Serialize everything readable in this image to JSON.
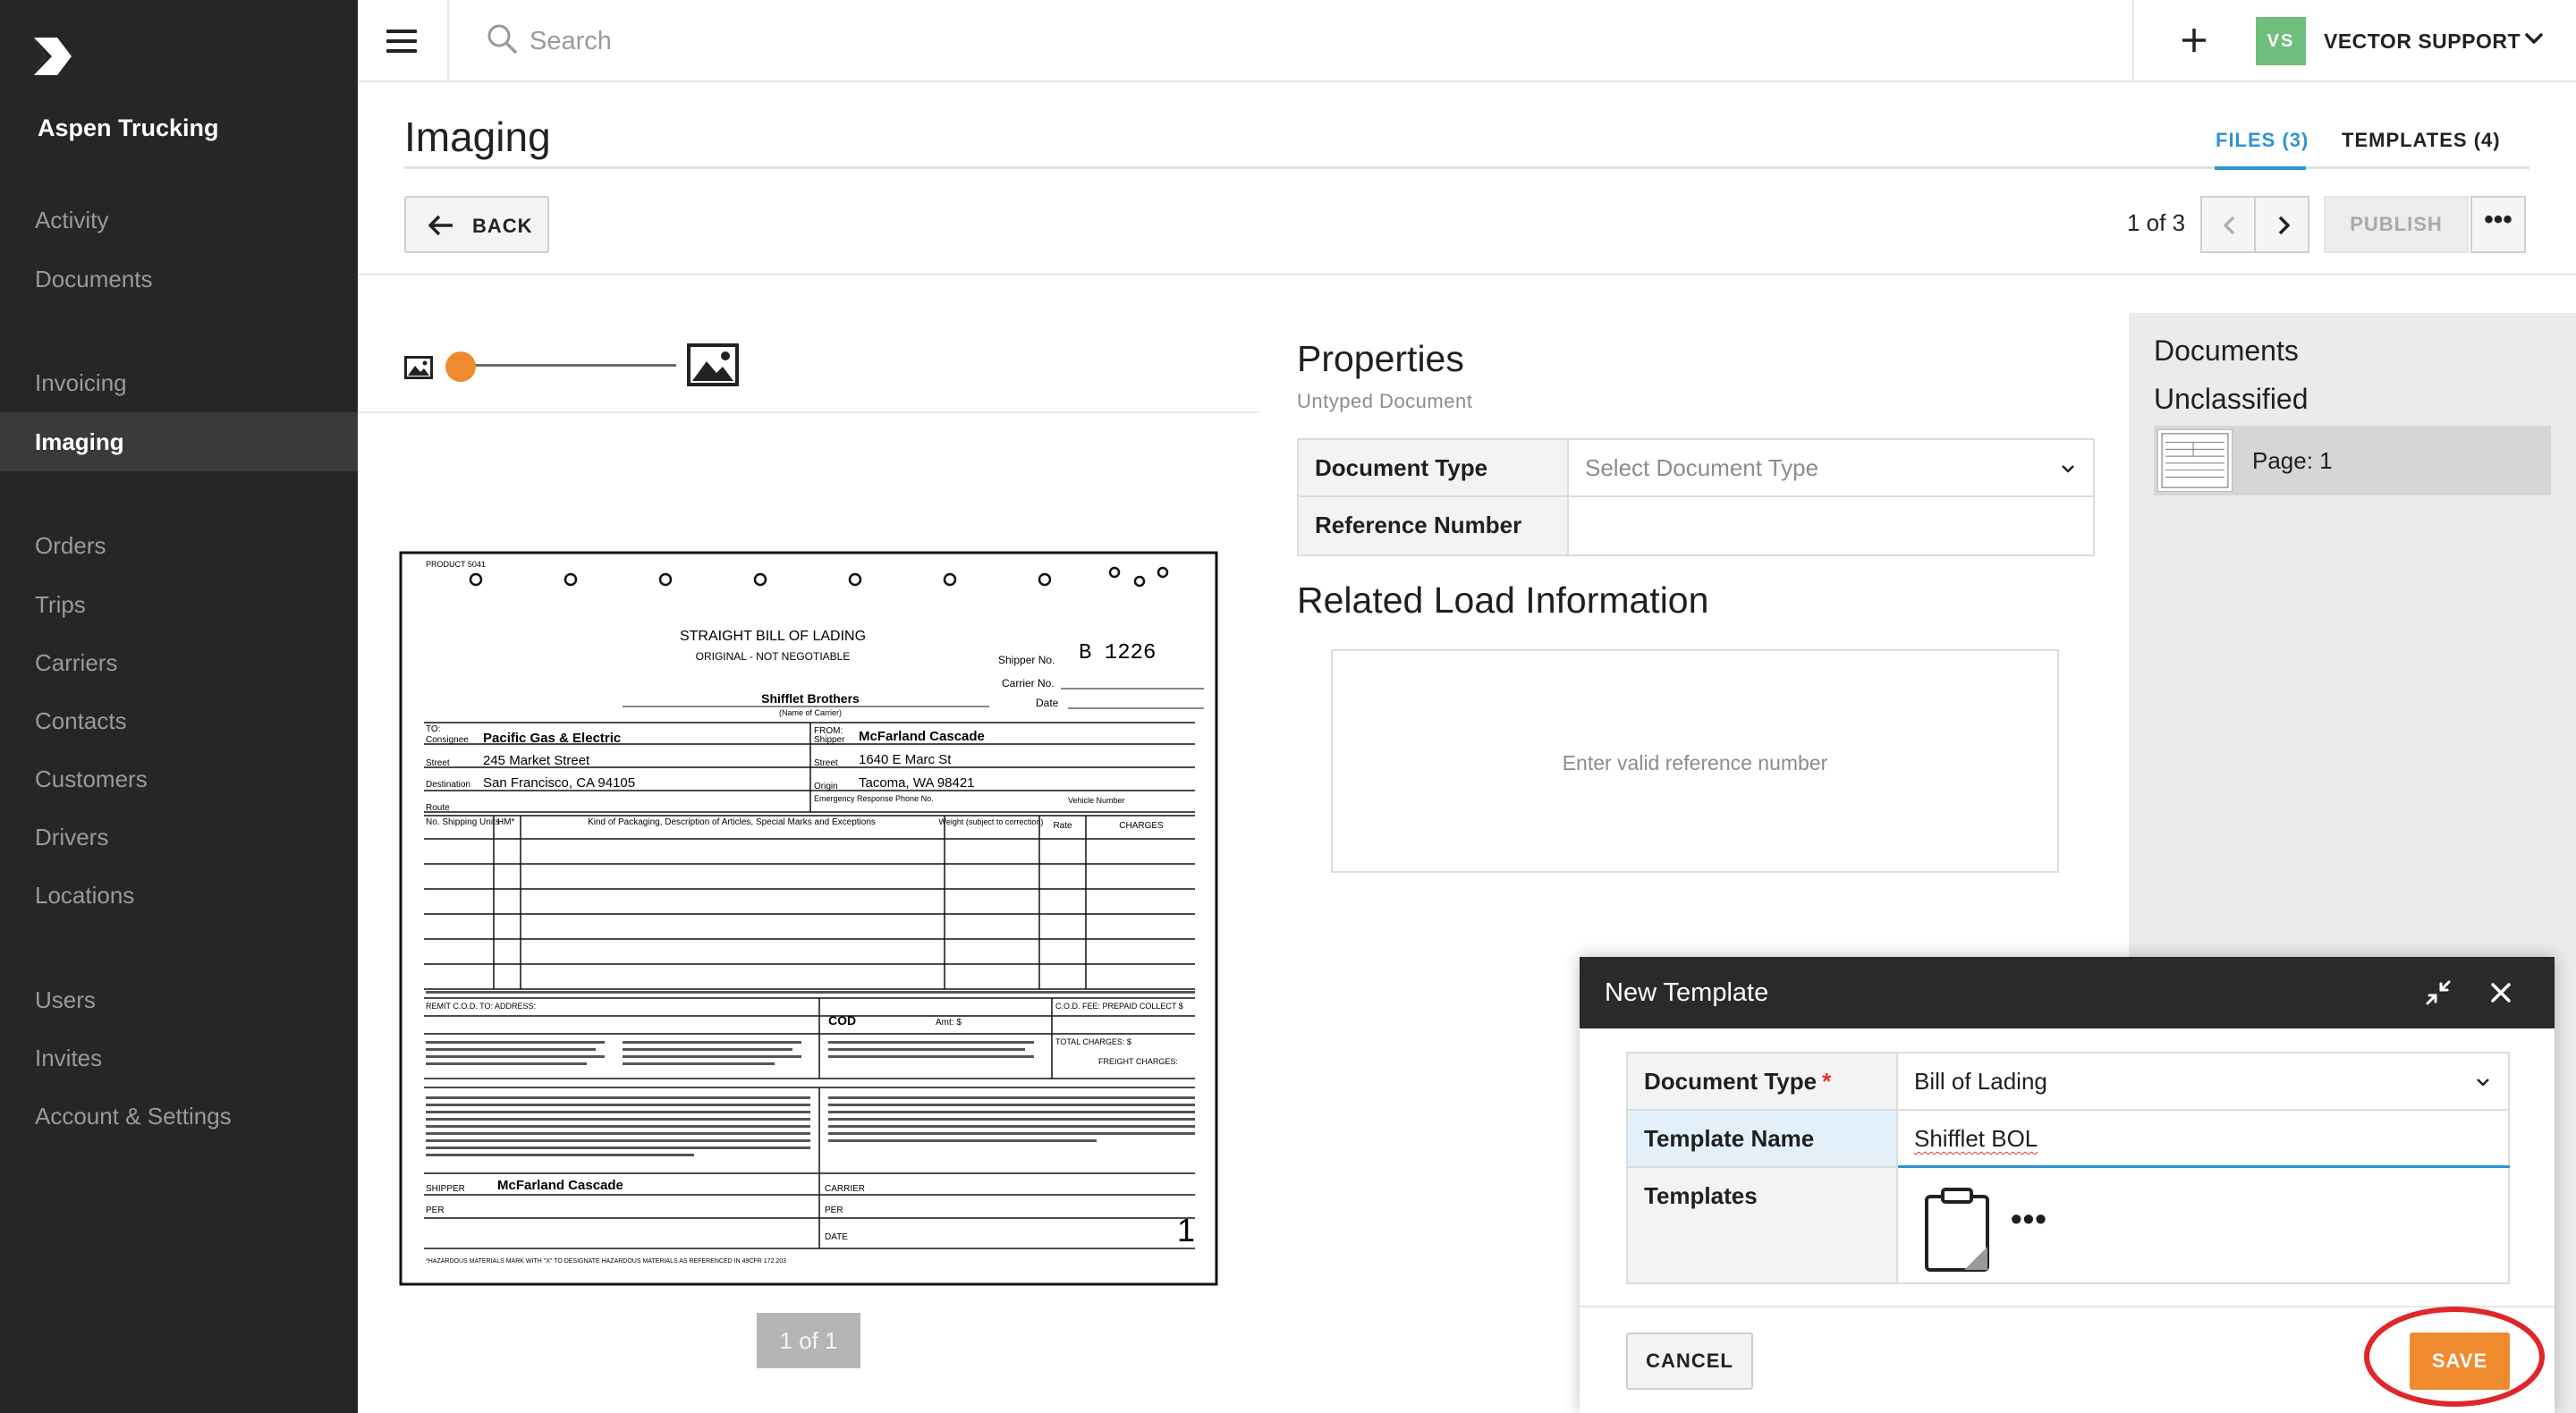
{
  "sidebar": {
    "company": "Aspen Trucking",
    "items": [
      {
        "label": "Activity"
      },
      {
        "label": "Documents"
      },
      {
        "label": "Invoicing"
      },
      {
        "label": "Imaging",
        "active": true
      },
      {
        "label": "Orders"
      },
      {
        "label": "Trips"
      },
      {
        "label": "Carriers"
      },
      {
        "label": "Contacts"
      },
      {
        "label": "Customers"
      },
      {
        "label": "Drivers"
      },
      {
        "label": "Locations"
      },
      {
        "label": "Users"
      },
      {
        "label": "Invites"
      },
      {
        "label": "Account & Settings"
      }
    ]
  },
  "topbar": {
    "search_placeholder": "Search",
    "avatar_initials": "VS",
    "user_name": "VECTOR SUPPORT"
  },
  "header": {
    "title": "Imaging",
    "tabs": [
      {
        "label": "FILES (3)",
        "active": true
      },
      {
        "label": "TEMPLATES (4)"
      }
    ]
  },
  "toolbar": {
    "back_label": "BACK",
    "pager": "1 of 3",
    "publish_label": "PUBLISH",
    "more_label": "•••"
  },
  "viewer": {
    "zoom_level": 0.0,
    "page_counter": "1 of 1",
    "document": {
      "product": "PRODUCT 5041",
      "title": "STRAIGHT BILL OF LADING",
      "subtitle": "ORIGINAL - NOT NEGOTIABLE",
      "shipper_no_label": "Shipper No.",
      "shipper_no": "B  1226",
      "carrier_no_label": "Carrier No.",
      "date_label": "Date",
      "carrier_name": "Shifflet Brothers",
      "name_of_carrier": "(Name of Carrier)",
      "to_label": "TO:",
      "consignee_label": "Consignee",
      "consignee": "Pacific Gas & Electric",
      "street_label": "Street",
      "consignee_street": "245 Market Street",
      "destination_label": "Destination",
      "destination": "San Francisco, CA 94105",
      "route_label": "Route",
      "from_label": "FROM:",
      "shipper_label": "Shipper",
      "shipper": "McFarland Cascade",
      "shipper_street": "1640 E Marc St",
      "origin_label": "Origin",
      "origin": "Tacoma, WA 98421",
      "emergency_label": "Emergency Response Phone No.",
      "vehicle_label": "Vehicle Number",
      "col_units": "No. Shipping Units",
      "col_hm": "HM*",
      "col_kind": "Kind of Packaging, Description of Articles, Special Marks and Exceptions",
      "col_weight": "Weight (subject to correction)",
      "col_rate": "Rate",
      "col_charges": "CHARGES",
      "remit_label": "REMIT C.O.D. TO: ADDRESS:",
      "cod_label": "COD",
      "amt_label": "Amt: $",
      "cod_fee_label": "C.O.D. FEE: PREPAID COLLECT $",
      "total_charges_label": "TOTAL CHARGES: $",
      "freight_charges_label": "FREIGHT CHARGES:",
      "shipper_sig_label": "SHIPPER",
      "shipper_sig": "McFarland Cascade",
      "per_label": "PER",
      "carrier_sig_label": "CARRIER",
      "date_sig_label": "DATE",
      "page_mark": "1",
      "hazmat_footer": "*HAZARDOUS MATERIALS    MARK WITH \"X\" TO DESIGNATE HAZARDOUS MATERIALS AS REFERENCED IN 49CFR 172.203"
    }
  },
  "properties": {
    "title": "Properties",
    "subtitle": "Untyped Document",
    "rows": [
      {
        "label": "Document Type",
        "value": "Select Document Type"
      },
      {
        "label": "Reference Number",
        "value": ""
      }
    ],
    "related_title": "Related Load Information",
    "related_placeholder": "Enter valid reference number"
  },
  "documents_panel": {
    "title": "Documents",
    "subtitle": "Unclassified",
    "items": [
      {
        "label": "Page: 1"
      }
    ]
  },
  "modal": {
    "title": "New Template",
    "rows": [
      {
        "label": "Document Type",
        "value": "Bill of Lading",
        "required": "*"
      },
      {
        "label": "Template Name",
        "value": "Shifflet BOL"
      },
      {
        "label": "Templates",
        "more": "•••"
      }
    ],
    "cancel_label": "CANCEL",
    "save_label": "SAVE"
  },
  "colors": {
    "accent": "#2f93d4",
    "primary_action": "#f08a2f",
    "highlight_circle": "#e0252b",
    "sidebar_bg": "#262626",
    "avatar": "#6fbe7e"
  }
}
